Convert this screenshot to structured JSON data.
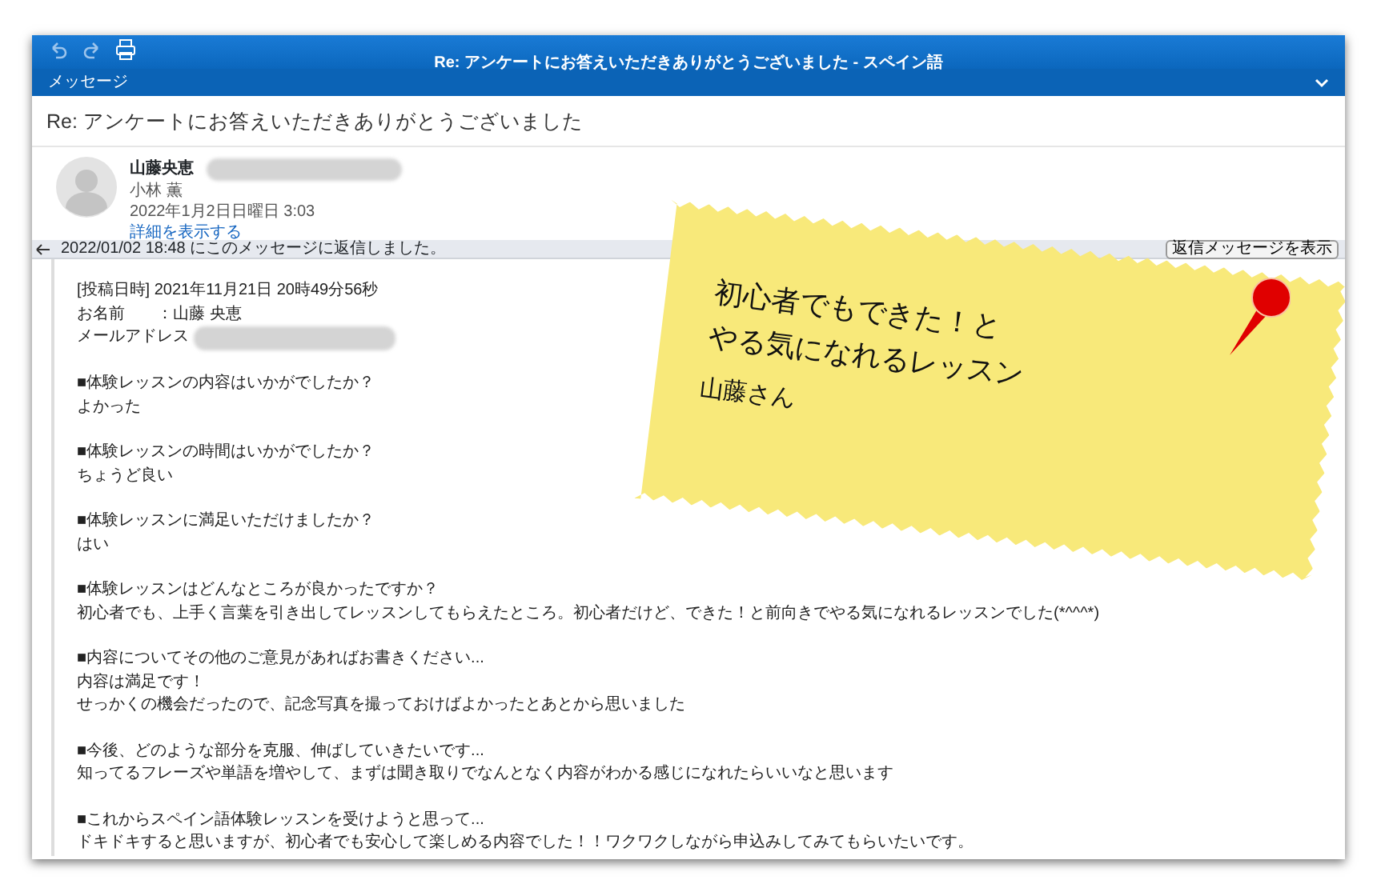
{
  "window": {
    "title": "Re: アンケートにお答えいただきありがとうございました - スペイン語"
  },
  "ribbon": {
    "label": "メッセージ"
  },
  "subject": "Re: アンケートにお答えいただきありがとうございました",
  "sender": {
    "name": "山藤央恵",
    "recipient": "小林 薫",
    "date": "2022年1月2日日曜日 3:03",
    "details_link": "詳細を表示する"
  },
  "reply_notice": {
    "text": "2022/01/02 18:48 にこのメッセージに返信しました。",
    "button": "返信メッセージを表示"
  },
  "body": [
    {
      "lines": [
        {
          "kind": "text",
          "text": "[投稿日時] 2021年11月21日 20時49分56秒"
        },
        {
          "kind": "text",
          "text": "お名前　　：山藤 央恵"
        },
        {
          "kind": "redacted",
          "text": "メールアドレス"
        }
      ]
    },
    {
      "lines": [
        {
          "kind": "text",
          "text": "■体験レッスンの内容はいかがでしたか？"
        },
        {
          "kind": "text",
          "text": "よかった"
        }
      ]
    },
    {
      "lines": [
        {
          "kind": "text",
          "text": "■体験レッスンの時間はいかがでしたか？"
        },
        {
          "kind": "text",
          "text": "ちょうど良い"
        }
      ]
    },
    {
      "lines": [
        {
          "kind": "text",
          "text": "■体験レッスンに満足いただけましたか？"
        },
        {
          "kind": "text",
          "text": "はい"
        }
      ]
    },
    {
      "lines": [
        {
          "kind": "text",
          "text": "■体験レッスンはどんなところが良かったですか？"
        },
        {
          "kind": "text",
          "text": "初心者でも、上手く言葉を引き出してレッスンしてもらえたところ。初心者だけど、できた！と前向きでやる気になれるレッスンでした(*^^^*)"
        }
      ]
    },
    {
      "lines": [
        {
          "kind": "text",
          "text": "■内容についてその他のご意見があればお書きください..."
        },
        {
          "kind": "text",
          "text": "内容は満足です！"
        },
        {
          "kind": "text",
          "text": "せっかくの機会だったので、記念写真を撮っておけばよかったとあとから思いました"
        }
      ]
    },
    {
      "lines": [
        {
          "kind": "text",
          "text": "■今後、どのような部分を克服、伸ばしていきたいです..."
        },
        {
          "kind": "text",
          "text": "知ってるフレーズや単語を増やして、まずは聞き取りでなんとなく内容がわかる感じになれたらいいなと思います"
        }
      ]
    },
    {
      "lines": [
        {
          "kind": "text",
          "text": "■これからスペイン語体験レッスンを受けようと思って..."
        },
        {
          "kind": "text",
          "text": "ドキドキすると思いますが、初心者でも安心して楽しめる内容でした！！ワクワクしながら申込みしてみてもらいたいです。"
        }
      ]
    }
  ],
  "sticky_note": {
    "lines": [
      "初心者でもできた！と",
      "やる気になれるレッスン"
    ],
    "signature": "山藤さん"
  }
}
